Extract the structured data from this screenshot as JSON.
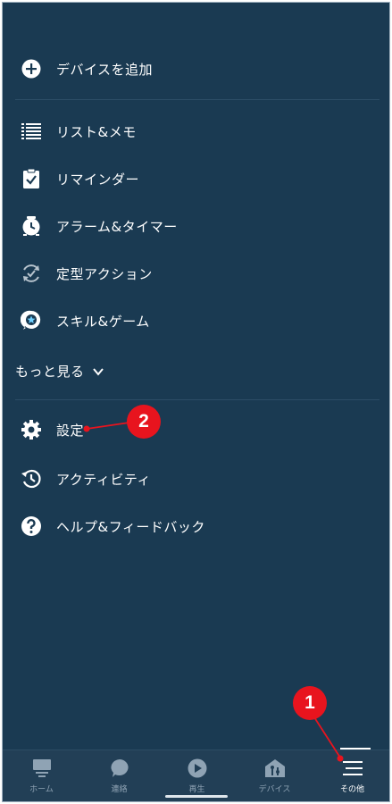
{
  "menu": {
    "add_device": "デバイスを追加",
    "lists_notes": "リスト&メモ",
    "reminders": "リマインダー",
    "alarms_timers": "アラーム&タイマー",
    "routines": "定型アクション",
    "skills_games": "スキル&ゲーム",
    "see_more": "もっと見る",
    "settings": "設定",
    "activity": "アクティビティ",
    "help_feedback": "ヘルプ&フィードバック"
  },
  "nav": {
    "home": "ホーム",
    "communicate": "連絡",
    "play": "再生",
    "devices": "デバイス",
    "more": "その他"
  },
  "annotations": {
    "badge1": "1",
    "badge2": "2"
  },
  "colors": {
    "background": "#1a3a52",
    "nav_background": "#223f56",
    "badge": "#e8141e"
  }
}
